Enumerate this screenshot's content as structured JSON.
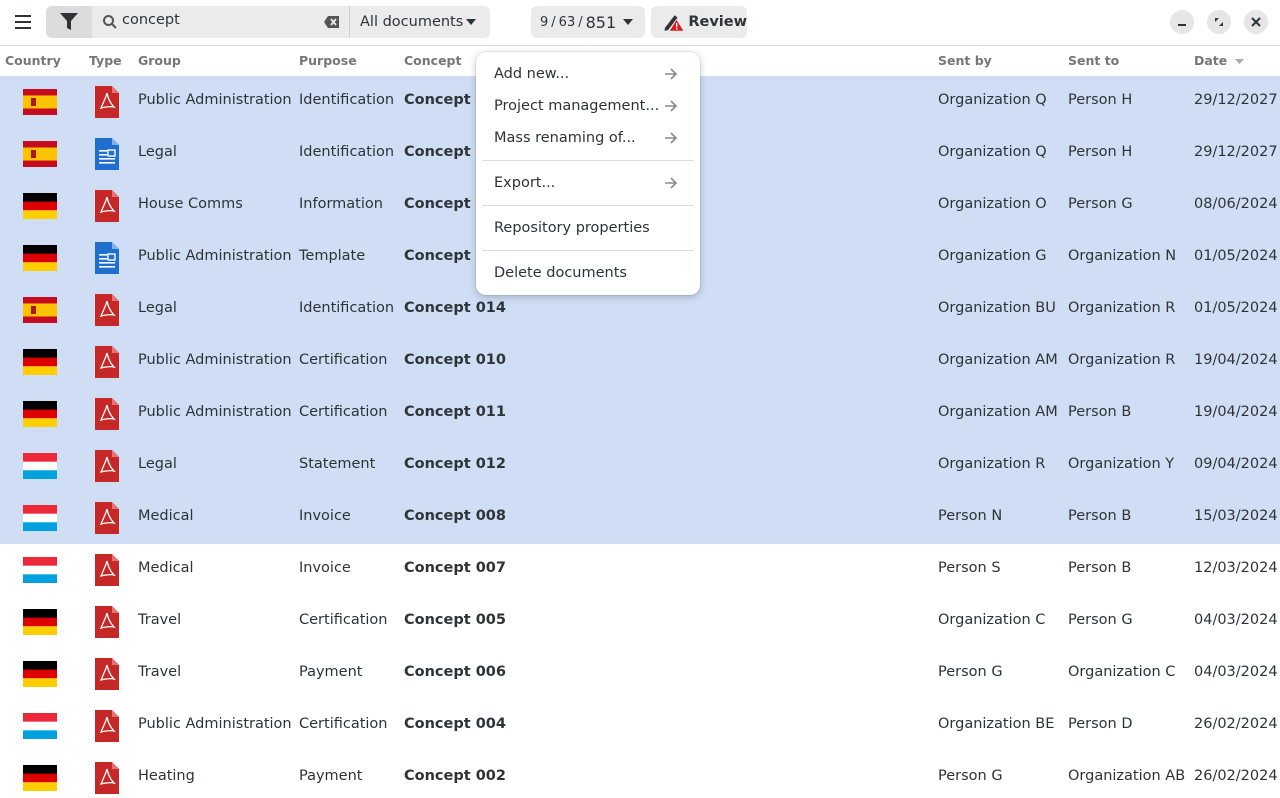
{
  "header": {
    "search": {
      "value": "concept",
      "placeholder": ""
    },
    "scope": "All documents",
    "counter": {
      "selected": "9",
      "filtered": "63",
      "total": "851",
      "sep": "/"
    },
    "review_label": "Review"
  },
  "columns": {
    "country": "Country",
    "type": "Type",
    "group": "Group",
    "purpose": "Purpose",
    "concept": "Concept",
    "sent_by": "Sent by",
    "sent_to": "Sent to",
    "date": "Date"
  },
  "rows": [
    {
      "country": "es",
      "type": "pdf",
      "group": "Public Administration",
      "purpose": "Identification",
      "concept": "Concept 0",
      "sent_by": "Organization Q",
      "sent_to": "Person H",
      "date": "29/12/2027",
      "selected": true
    },
    {
      "country": "es",
      "type": "doc",
      "group": "Legal",
      "purpose": "Identification",
      "concept": "Concept 0",
      "sent_by": "Organization Q",
      "sent_to": "Person H",
      "date": "29/12/2027",
      "selected": true
    },
    {
      "country": "de",
      "type": "pdf",
      "group": "House Comms",
      "purpose": "Information",
      "concept": "Concept 0",
      "sent_by": "Organization O",
      "sent_to": "Person G",
      "date": "08/06/2024",
      "selected": true
    },
    {
      "country": "de",
      "type": "doc",
      "group": "Public Administration",
      "purpose": "Template",
      "concept": "Concept 0",
      "sent_by": "Organization G",
      "sent_to": "Organization N",
      "date": "01/05/2024",
      "selected": true
    },
    {
      "country": "es",
      "type": "pdf",
      "group": "Legal",
      "purpose": "Identification",
      "concept": "Concept 014",
      "sent_by": "Organization BU",
      "sent_to": "Organization R",
      "date": "01/05/2024",
      "selected": true
    },
    {
      "country": "de",
      "type": "pdf",
      "group": "Public Administration",
      "purpose": "Certification",
      "concept": "Concept 010",
      "sent_by": "Organization AM",
      "sent_to": "Organization R",
      "date": "19/04/2024",
      "selected": true
    },
    {
      "country": "de",
      "type": "pdf",
      "group": "Public Administration",
      "purpose": "Certification",
      "concept": "Concept 011",
      "sent_by": "Organization AM",
      "sent_to": "Person B",
      "date": "19/04/2024",
      "selected": true
    },
    {
      "country": "lu",
      "type": "pdf",
      "group": "Legal",
      "purpose": "Statement",
      "concept": "Concept 012",
      "sent_by": "Organization R",
      "sent_to": "Organization Y",
      "date": "09/04/2024",
      "selected": true
    },
    {
      "country": "lu",
      "type": "pdf",
      "group": "Medical",
      "purpose": "Invoice",
      "concept": "Concept 008",
      "sent_by": "Person N",
      "sent_to": "Person B",
      "date": "15/03/2024",
      "selected": true
    },
    {
      "country": "lu",
      "type": "pdf",
      "group": "Medical",
      "purpose": "Invoice",
      "concept": "Concept 007",
      "sent_by": "Person S",
      "sent_to": "Person B",
      "date": "12/03/2024",
      "selected": false
    },
    {
      "country": "de",
      "type": "pdf",
      "group": "Travel",
      "purpose": "Certification",
      "concept": "Concept 005",
      "sent_by": "Organization C",
      "sent_to": "Person G",
      "date": "04/03/2024",
      "selected": false
    },
    {
      "country": "de",
      "type": "pdf",
      "group": "Travel",
      "purpose": "Payment",
      "concept": "Concept 006",
      "sent_by": "Person G",
      "sent_to": "Organization C",
      "date": "04/03/2024",
      "selected": false
    },
    {
      "country": "lu",
      "type": "pdf",
      "group": "Public Administration",
      "purpose": "Certification",
      "concept": "Concept 004",
      "sent_by": "Organization BE",
      "sent_to": "Person D",
      "date": "26/02/2024",
      "selected": false
    },
    {
      "country": "de",
      "type": "pdf",
      "group": "Heating",
      "purpose": "Payment",
      "concept": "Concept 002",
      "sent_by": "Person G",
      "sent_to": "Organization AB",
      "date": "26/02/2024",
      "selected": false
    }
  ],
  "popover": {
    "items": [
      {
        "label": "Add new...",
        "submenu": true
      },
      {
        "label": "Project management...",
        "submenu": true
      },
      {
        "label": "Mass renaming of...",
        "submenu": true
      },
      {
        "label": "Export...",
        "submenu": true
      },
      {
        "label": "Repository properties",
        "submenu": false
      },
      {
        "label": "Delete documents",
        "submenu": false
      }
    ]
  },
  "colors": {
    "selection": "#cfdef5",
    "pdf": "#c62828",
    "doc": "#1e6fd0",
    "warning": "#e01b24"
  },
  "icons": [
    "menu-icon",
    "filter-icon",
    "search-icon",
    "clear-icon",
    "chevron-down-icon",
    "edit-warning-icon",
    "minimize-icon",
    "maximize-icon",
    "close-icon",
    "arrow-right-icon",
    "sort-descending-icon"
  ]
}
